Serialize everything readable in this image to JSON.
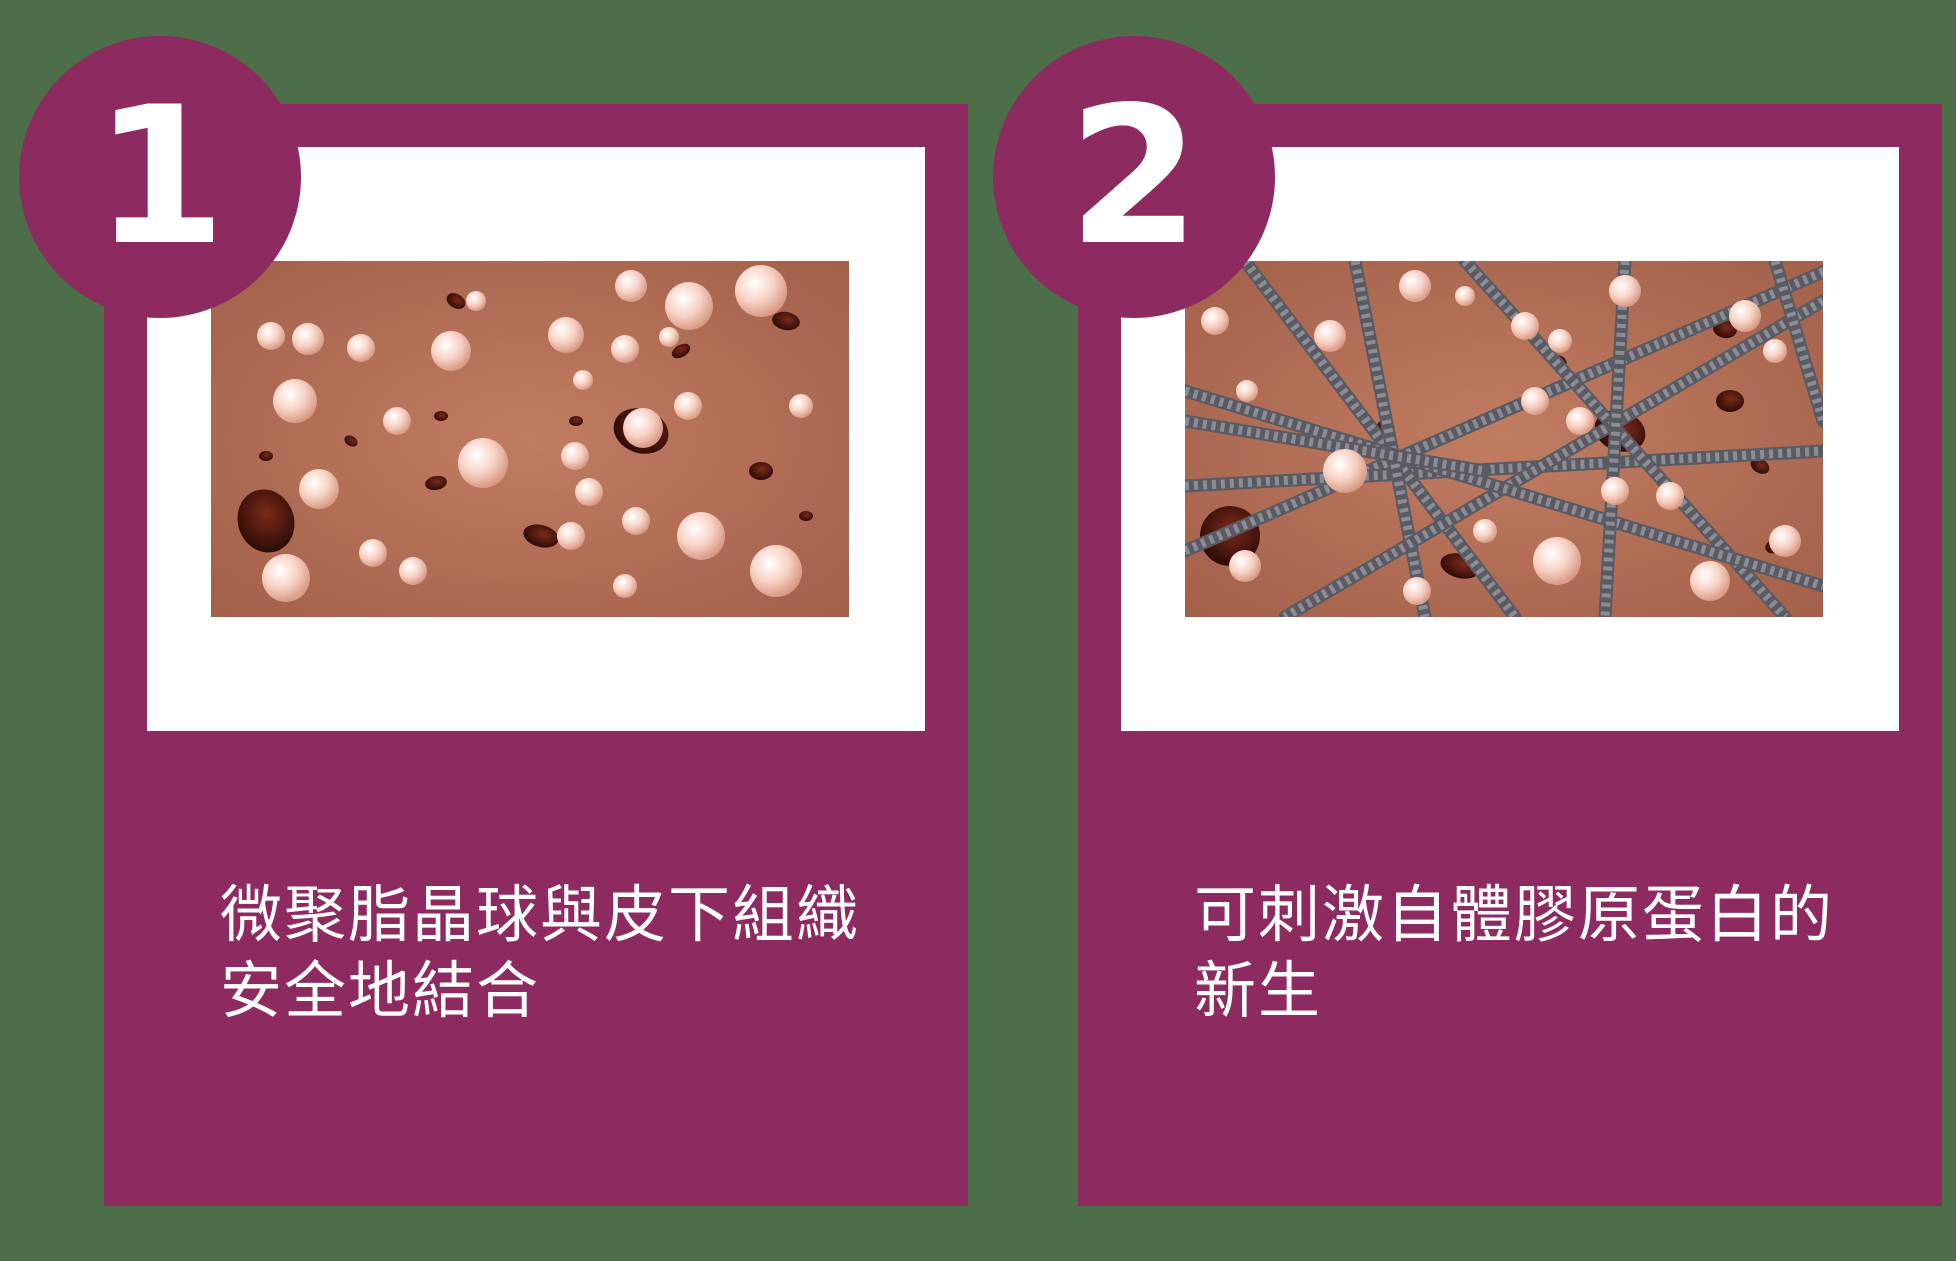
{
  "steps": [
    {
      "number": "1",
      "caption": "微聚脂晶球與皮下組織\n安全地結合"
    },
    {
      "number": "2",
      "caption": "可刺激自體膠原蛋白的\n新生"
    }
  ],
  "colors": {
    "background": "#4c6e49",
    "card": "#8d2b61",
    "frame": "#ffffff",
    "text": "#ffffff",
    "tissue": "#b5735a"
  }
}
